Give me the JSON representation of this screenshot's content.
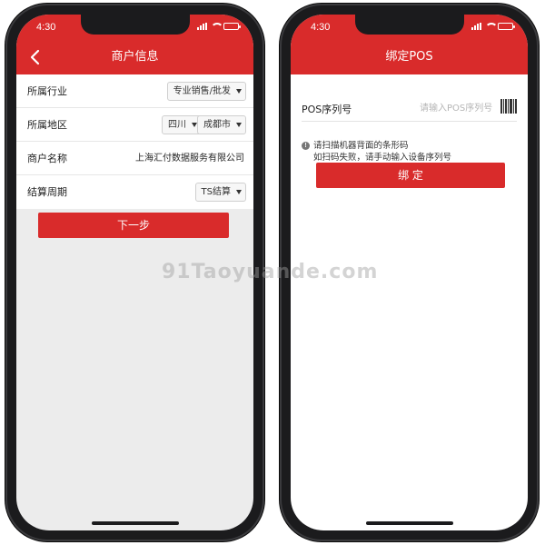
{
  "colors": {
    "brand_red": "#d92b2b",
    "background_gray": "#ececec"
  },
  "left_screen": {
    "status_time": "4:30",
    "nav_title": "商户信息",
    "back_icon": "chevron-left-icon",
    "fields": {
      "industry": {
        "label": "所属行业",
        "value": "专业销售/批发"
      },
      "region": {
        "label": "所属地区",
        "province": "四川",
        "city": "成都市"
      },
      "merchant": {
        "label": "商户名称",
        "value": "上海汇付数据服务有限公司"
      },
      "settlement": {
        "label": "结算周期",
        "value": "TS结算"
      }
    },
    "next_button": "下一步"
  },
  "right_screen": {
    "status_time": "4:30",
    "nav_title": "绑定POS",
    "serial_label": "POS序列号",
    "serial_placeholder": "请输入POS序列号",
    "barcode_icon": "barcode-scan-icon",
    "hint_line1": "请扫描机器背面的条形码",
    "hint_line2": "如扫码失败，请手动输入设备序列号",
    "bind_button": "绑  定"
  },
  "watermark": "91Taoyuande.com"
}
